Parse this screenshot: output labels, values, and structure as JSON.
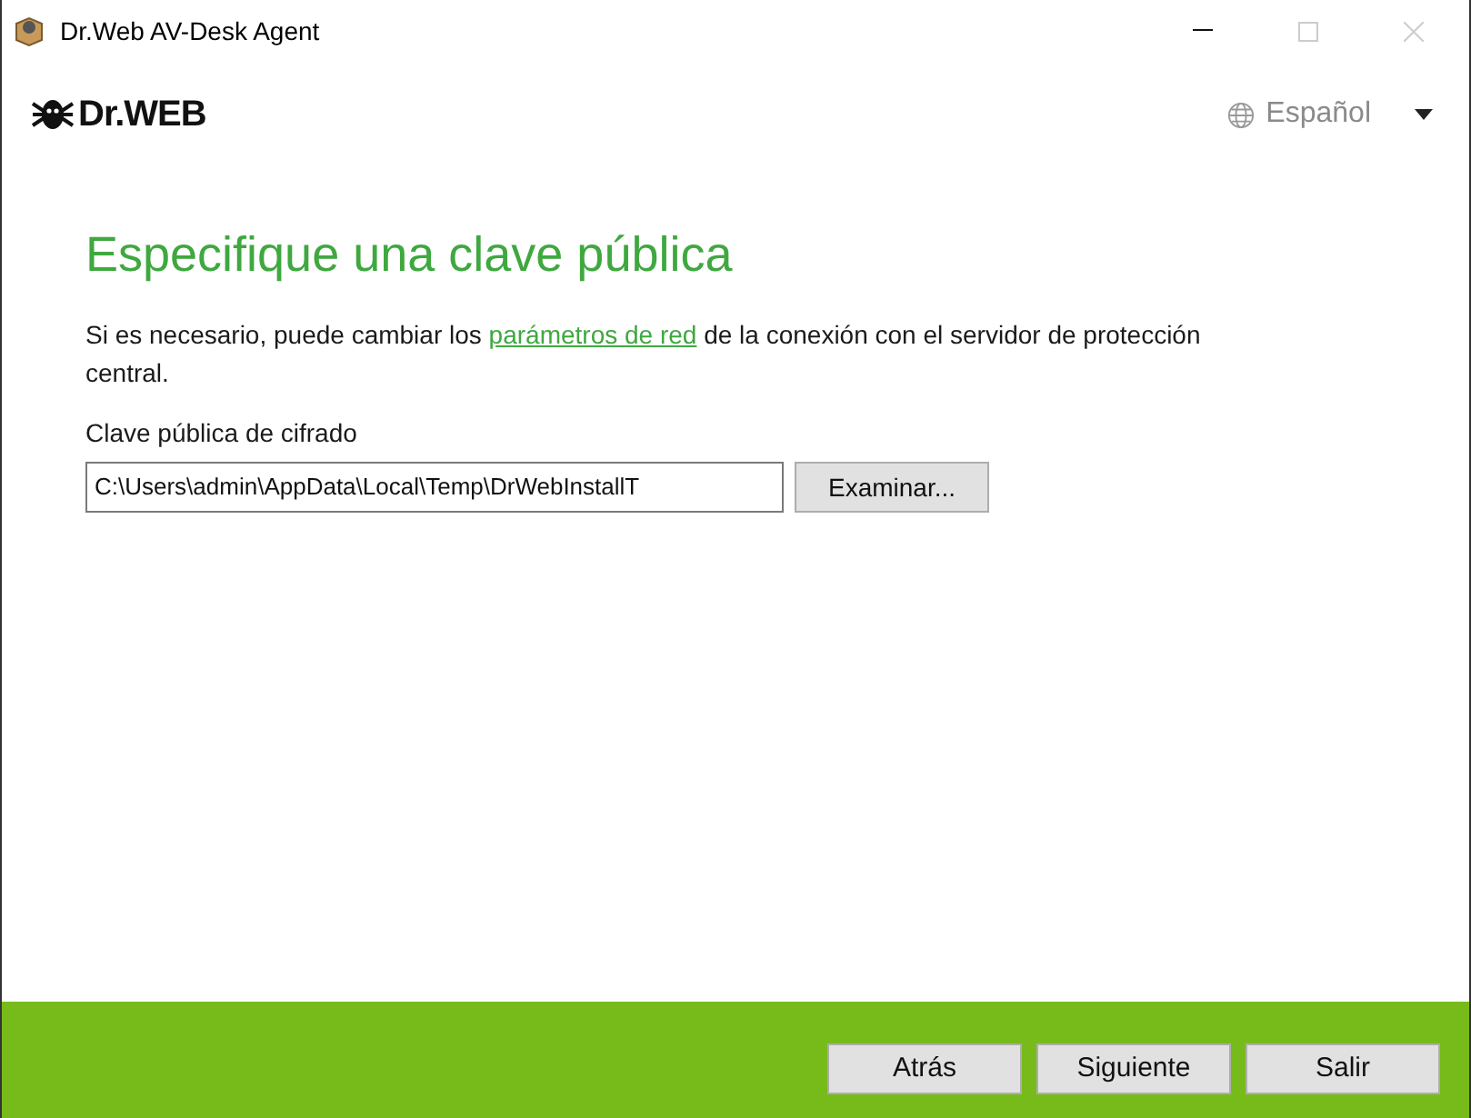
{
  "window": {
    "title": "Dr.Web AV-Desk Agent",
    "controls": [
      {
        "kind": "minimize",
        "disabled": false
      },
      {
        "kind": "maximize",
        "disabled": true
      },
      {
        "kind": "close",
        "disabled": true
      }
    ]
  },
  "header": {
    "logo_text": "Dr.WEB",
    "language": "Español"
  },
  "heading": "Especifique una clave pública",
  "intro": {
    "before": "Si es necesario, puede cambiar los",
    "link": "parámetros de red",
    "after": "de la conexión con el servidor de protección central."
  },
  "key_field": {
    "label": "Clave pública de cifrado",
    "value": "C:\\Users\\admin\\AppData\\Local\\Temp\\DrWebInstallT",
    "browse_button": "Examinar..."
  },
  "footer_buttons": [
    "Atrás",
    "Siguiente",
    "Salir"
  ]
}
